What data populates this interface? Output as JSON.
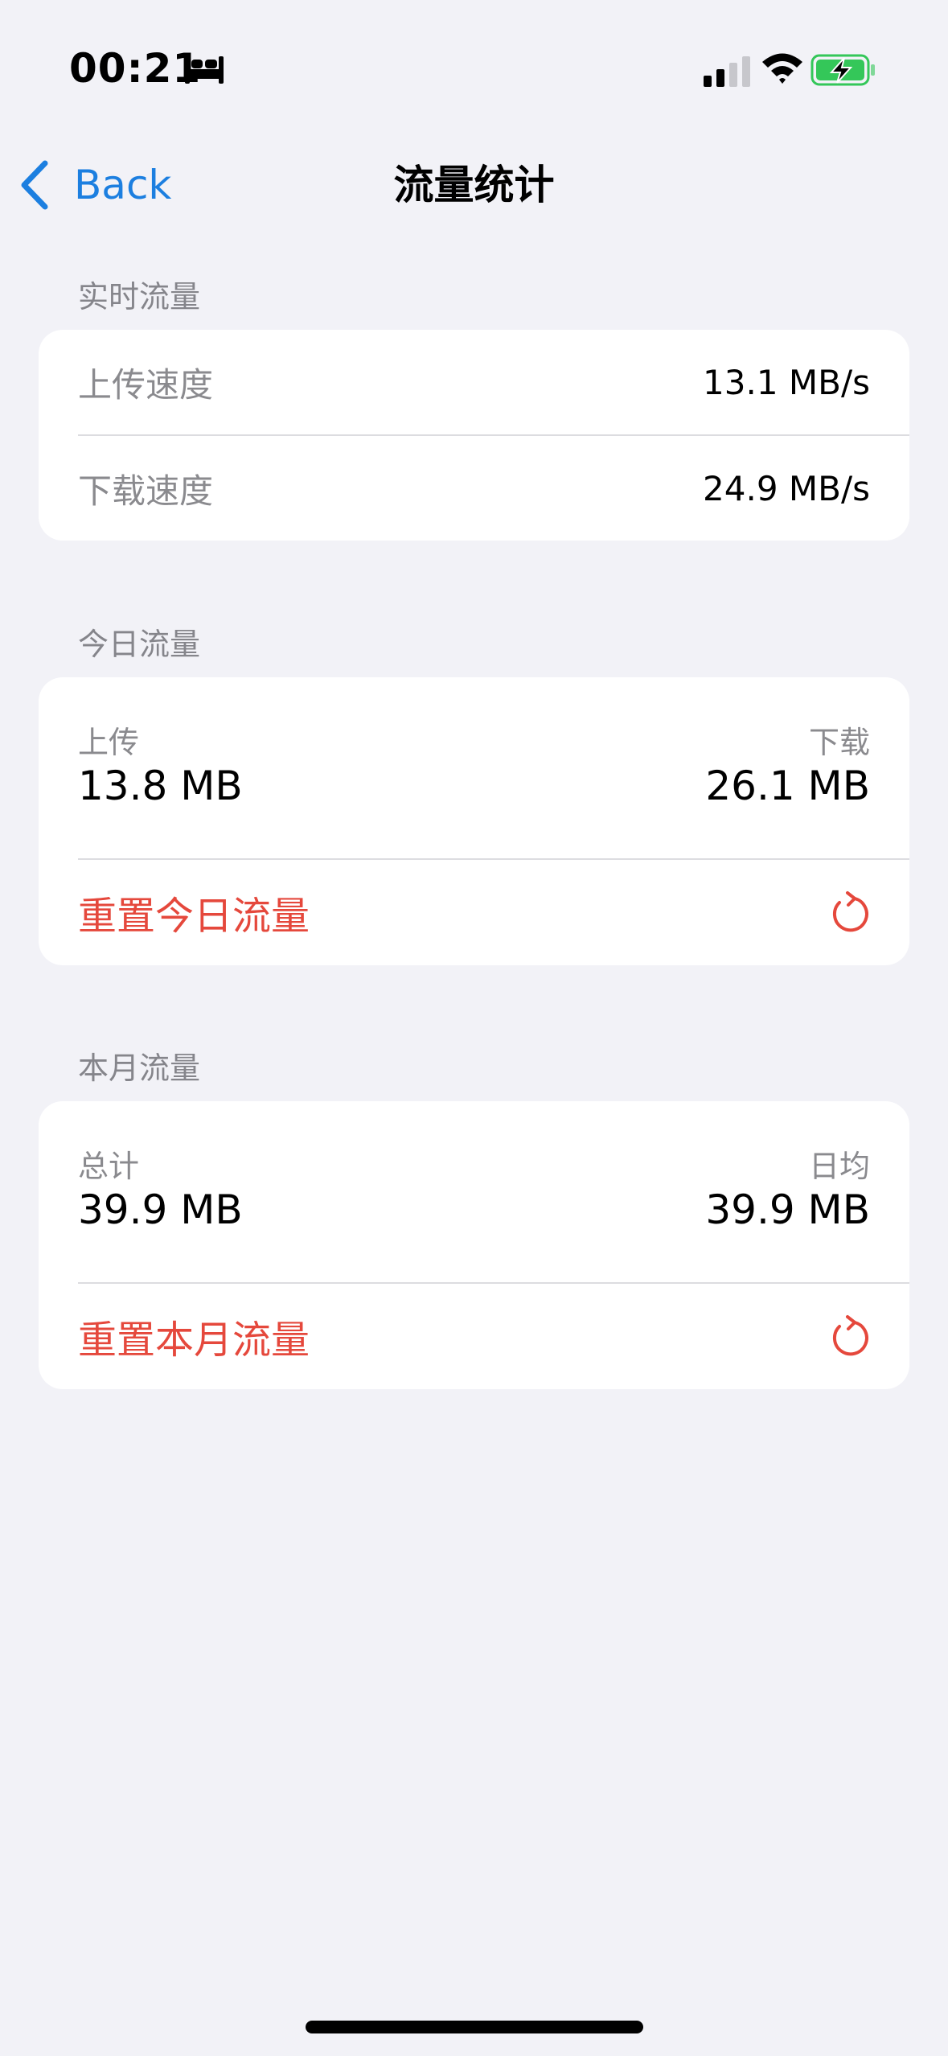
{
  "status_bar": {
    "time": "00:21",
    "icons": [
      "sleep-bed-icon",
      "cellular-signal-icon",
      "wifi-icon",
      "battery-charging-icon"
    ],
    "battery_color": "#34c759"
  },
  "nav": {
    "back_label": "Back",
    "title": "流量统计",
    "accent": "#1c7fe0"
  },
  "realtime": {
    "header": "实时流量",
    "rows": [
      {
        "label": "上传速度",
        "value": "13.1 MB/s"
      },
      {
        "label": "下载速度",
        "value": "24.9 MB/s"
      }
    ]
  },
  "today": {
    "header": "今日流量",
    "upload_label": "上传",
    "upload_value": "13.8 MB",
    "download_label": "下载",
    "download_value": "26.1 MB",
    "reset_label": "重置今日流量"
  },
  "month": {
    "header": "本月流量",
    "total_label": "总计",
    "total_value": "39.9 MB",
    "daily_label": "日均",
    "daily_value": "39.9 MB",
    "reset_label": "重置本月流量"
  },
  "colors": {
    "destructive": "#e5483c",
    "background": "#f2f2f7"
  }
}
